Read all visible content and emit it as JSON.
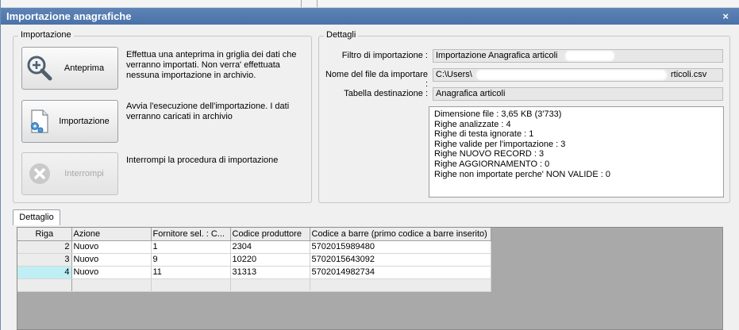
{
  "window": {
    "title": "Importazione anagrafiche",
    "close_glyph": "×"
  },
  "importazione_group": {
    "legend": "Importazione",
    "buttons": [
      {
        "label": "Anteprima",
        "icon": "magnifier-plus-icon",
        "description": "Effettua una anteprima in griglia dei dati che verranno importati. Non verra' effettuata nessuna importazione in archivio."
      },
      {
        "label": "Importazione",
        "icon": "document-gear-icon",
        "description": "Avvia l'esecuzione dell'importazione. I dati verranno caricati in archivio"
      },
      {
        "label": "Interrompi",
        "icon": "cancel-circle-icon",
        "description": "Interrompi la procedura di importazione"
      }
    ]
  },
  "dettagli_group": {
    "legend": "Dettagli",
    "filtro_label": "Filtro di importazione :",
    "filtro_value": "Importazione Anagrafica articoli",
    "file_label": "Nome del file da importare :",
    "file_value_start": "C:\\Users\\",
    "file_value_end": "rticoli.csv",
    "tabella_label": "Tabella destinazione :",
    "tabella_value": "Anagrafica articoli",
    "stats": [
      "Dimensione file : 3,65 KB (3'733)",
      "Righe analizzate : 4",
      "Righe di testa ignorate : 1",
      "Righe valide per l'importazione : 3",
      "Righe NUOVO RECORD : 3",
      "Righe AGGIORNAMENTO  : 0",
      "Righe non importate perche' NON VALIDE : 0"
    ]
  },
  "tab": {
    "label": "Dettaglio"
  },
  "grid": {
    "columns": [
      "Riga",
      "Azione",
      "Fornitore sel. : C...",
      "Codice produttore",
      "Codice a barre (primo codice a barre inserito)"
    ],
    "rows": [
      [
        "2",
        "Nuovo",
        "1",
        "2304",
        "5702015989480"
      ],
      [
        "3",
        "Nuovo",
        "9",
        "10220",
        "5702015643092"
      ],
      [
        "4",
        "Nuovo",
        "11",
        "31313",
        "5702014982734"
      ]
    ],
    "selected_row": 2
  },
  "colors": {
    "titlebar": "#4a72a8",
    "selected_row_header": "#bfeff4",
    "grid_background": "#a9a9a9"
  }
}
